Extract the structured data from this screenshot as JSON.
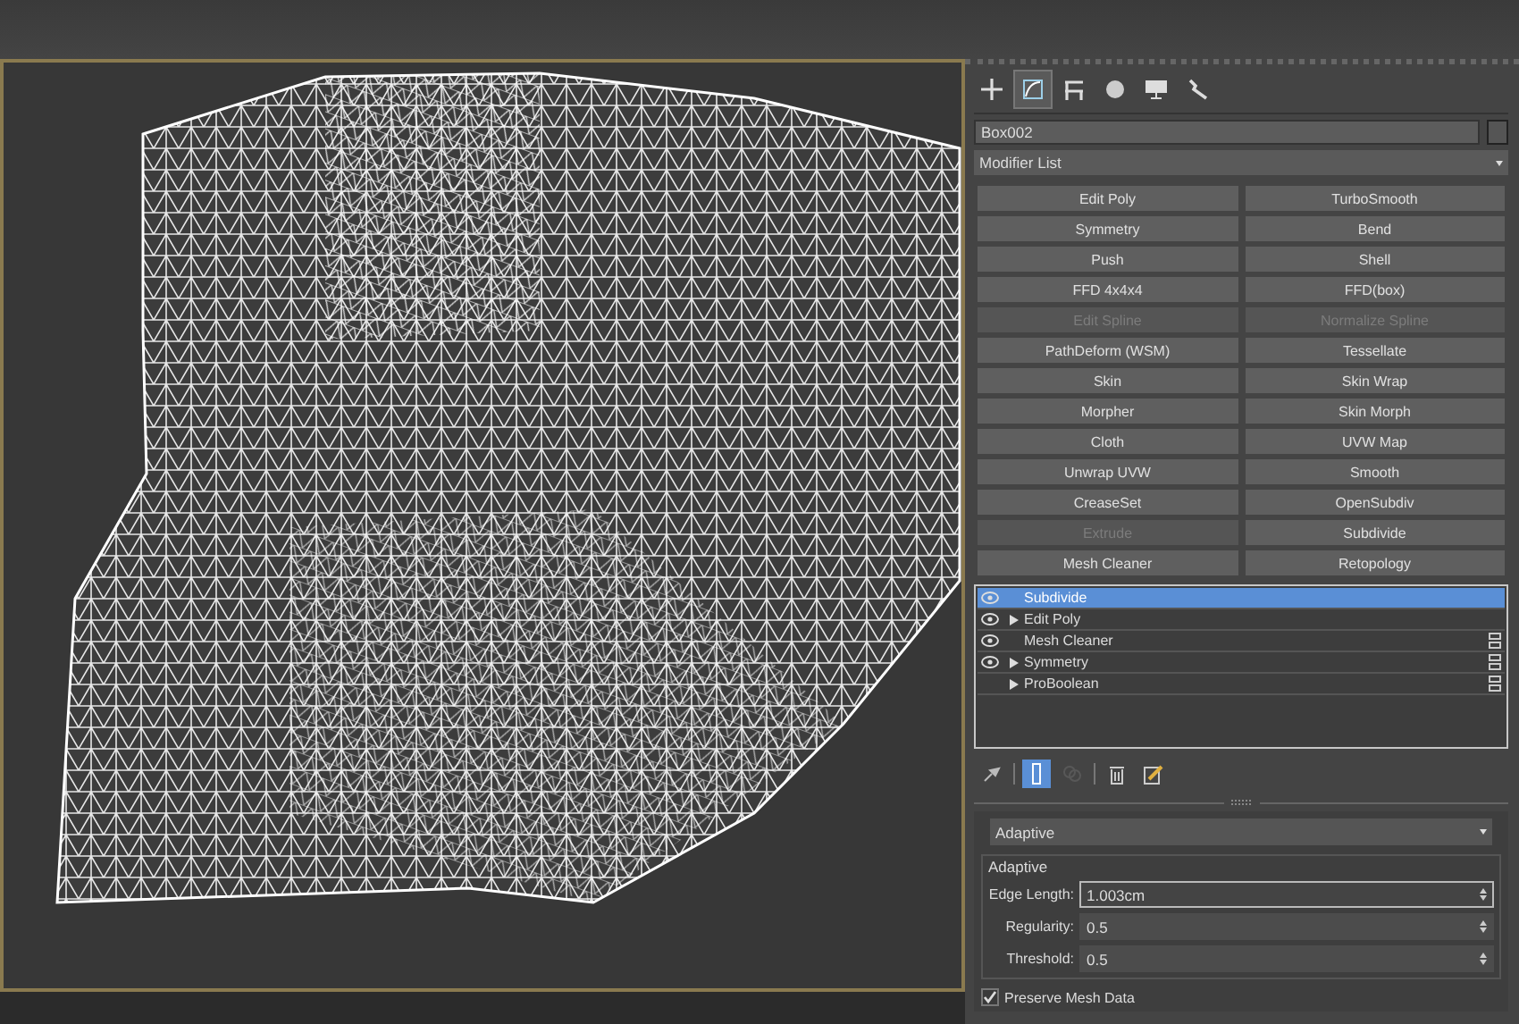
{
  "command_tabs": [
    {
      "kind": "create",
      "selected": false
    },
    {
      "kind": "modify",
      "selected": true
    },
    {
      "kind": "hierarchy",
      "selected": false
    },
    {
      "kind": "motion",
      "selected": false
    },
    {
      "kind": "display",
      "selected": false
    },
    {
      "kind": "utilities",
      "selected": false
    }
  ],
  "object_name": {
    "value": "Box002"
  },
  "modifier_list": {
    "label": "Modifier List"
  },
  "modifier_buttons": [
    {
      "label": "Edit Poly",
      "disabled": false
    },
    {
      "label": "TurboSmooth",
      "disabled": false
    },
    {
      "label": "Symmetry",
      "disabled": false
    },
    {
      "label": "Bend",
      "disabled": false
    },
    {
      "label": "Push",
      "disabled": false
    },
    {
      "label": "Shell",
      "disabled": false
    },
    {
      "label": "FFD 4x4x4",
      "disabled": false
    },
    {
      "label": "FFD(box)",
      "disabled": false
    },
    {
      "label": "Edit Spline",
      "disabled": true
    },
    {
      "label": "Normalize Spline",
      "disabled": true
    },
    {
      "label": "PathDeform (WSM)",
      "disabled": false
    },
    {
      "label": "Tessellate",
      "disabled": false
    },
    {
      "label": "Skin",
      "disabled": false
    },
    {
      "label": "Skin Wrap",
      "disabled": false
    },
    {
      "label": "Morpher",
      "disabled": false
    },
    {
      "label": "Skin Morph",
      "disabled": false
    },
    {
      "label": "Cloth",
      "disabled": false
    },
    {
      "label": "UVW Map",
      "disabled": false
    },
    {
      "label": "Unwrap UVW",
      "disabled": false
    },
    {
      "label": "Smooth",
      "disabled": false
    },
    {
      "label": "CreaseSet",
      "disabled": false
    },
    {
      "label": "OpenSubdiv",
      "disabled": false
    },
    {
      "label": "Extrude",
      "disabled": true
    },
    {
      "label": "Subdivide",
      "disabled": false
    },
    {
      "label": "Mesh Cleaner",
      "disabled": false
    },
    {
      "label": "Retopology",
      "disabled": false
    }
  ],
  "modifier_stack": [
    {
      "label": "Subdivide",
      "selected": true,
      "visible_eye": true,
      "expandable": false,
      "instance_icon": false
    },
    {
      "label": "Edit Poly",
      "selected": false,
      "visible_eye": true,
      "expandable": true,
      "instance_icon": false
    },
    {
      "label": "Mesh Cleaner",
      "selected": false,
      "visible_eye": true,
      "expandable": false,
      "instance_icon": true
    },
    {
      "label": "Symmetry",
      "selected": false,
      "visible_eye": true,
      "expandable": true,
      "instance_icon": true
    },
    {
      "label": "ProBoolean",
      "selected": false,
      "visible_eye": false,
      "expandable": true,
      "instance_icon": true
    }
  ],
  "stack_tools": [
    {
      "kind": "pin",
      "selected": false,
      "disabled": false
    },
    {
      "kind": "end-result",
      "selected": true,
      "disabled": false
    },
    {
      "kind": "unique",
      "selected": false,
      "disabled": true
    },
    {
      "kind": "delete",
      "selected": false,
      "disabled": false
    },
    {
      "kind": "configure",
      "selected": false,
      "disabled": false
    }
  ],
  "subdivide_mode": {
    "value": "Adaptive"
  },
  "adaptive_group": {
    "title": "Adaptive",
    "fields": [
      {
        "label": "Edge Length:",
        "value": "1.003cm",
        "focused": true
      },
      {
        "label": "Regularity:",
        "value": "0.5",
        "focused": false
      },
      {
        "label": "Threshold:",
        "value": "0.5",
        "focused": false
      }
    ]
  },
  "preserve_mesh_data": {
    "label": "Preserve Mesh Data",
    "checked": true
  }
}
